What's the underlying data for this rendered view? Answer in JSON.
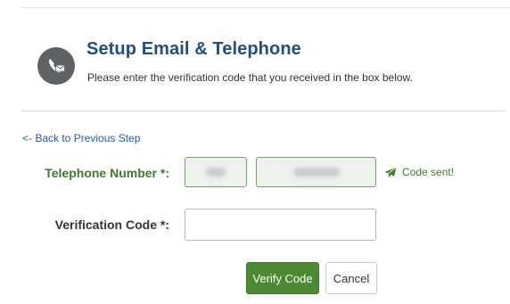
{
  "header": {
    "icon": "phone-envelope-icon",
    "title": "Setup Email & Telephone",
    "subtitle": "Please enter the verification code that you received in the box below."
  },
  "navigation": {
    "back_link": "<- Back to Previous Step"
  },
  "form": {
    "telephone_label": "Telephone Number *:",
    "telephone_area_value": "",
    "telephone_number_value": "",
    "code_sent_text": "Code sent!",
    "code_sent_icon": "paper-plane-icon",
    "verification_label": "Verification Code *:",
    "verification_value": ""
  },
  "buttons": {
    "verify_label": "Verify Code",
    "cancel_label": "Cancel"
  },
  "colors": {
    "title": "#1f4f82",
    "link": "#1f5fa8",
    "accent_green": "#4b8a32",
    "label_green": "#3d7a29"
  }
}
